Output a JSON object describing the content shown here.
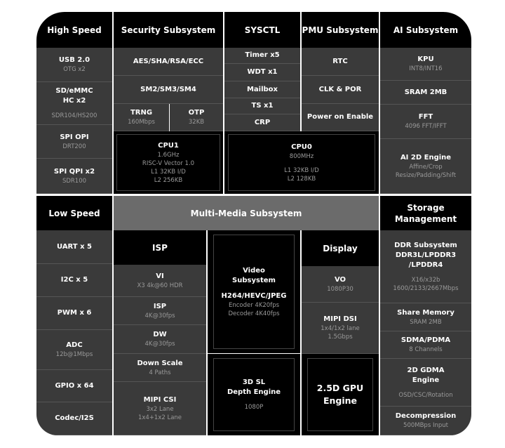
{
  "high_speed": {
    "header": "High Speed",
    "items": [
      {
        "title": "USB 2.0",
        "sub": "OTG x2"
      },
      {
        "title": "SD/eMMC\nHC x2",
        "sub": "SDR104/HS200"
      },
      {
        "title": "SPI OPI",
        "sub": "DRT200"
      },
      {
        "title": "SPI QPI x2",
        "sub": "SDR100"
      }
    ]
  },
  "security": {
    "header": "Security Subsystem",
    "items": [
      {
        "title": "AES/SHA/RSA/ECC"
      },
      {
        "title": "SM2/SM3/SM4"
      },
      {
        "title": "TRNG",
        "sub": "160Mbps"
      },
      {
        "title": "OTP",
        "sub": "32KB"
      }
    ]
  },
  "sysctl": {
    "header": "SYSCTL",
    "items": [
      {
        "title": "Timer x5"
      },
      {
        "title": "WDT x1"
      },
      {
        "title": "Mailbox"
      },
      {
        "title": "TS x1"
      },
      {
        "title": "CRP"
      }
    ]
  },
  "pmu": {
    "header": "PMU Subsystem",
    "items": [
      {
        "title": "RTC"
      },
      {
        "title": "CLK & POR"
      },
      {
        "title": "Power on Enable"
      }
    ]
  },
  "ai": {
    "header": "AI Subsystem",
    "items": [
      {
        "title": "KPU",
        "sub": "INT8/INT16"
      },
      {
        "title": "SRAM 2MB"
      },
      {
        "title": "FFT",
        "sub": "4096 FFT/IFFT"
      },
      {
        "title": "AI 2D Engine",
        "sub": "Affine/Crop\nResize/Padding/Shift"
      }
    ]
  },
  "cpu1": {
    "title": "CPU1",
    "sub": "1.6GHz\nRISC-V Vector 1.0\nL1 32KB I/D\nL2 256KB"
  },
  "cpu0": {
    "title": "CPU0",
    "sub": "800MHz",
    "sub2": "L1 32KB I/D\nL2 128KB"
  },
  "low_speed": {
    "header": "Low Speed",
    "items": [
      {
        "title": "UART x 5"
      },
      {
        "title": "I2C x 5"
      },
      {
        "title": "PWM x 6"
      },
      {
        "title": "ADC",
        "sub": "12b@1Mbps"
      },
      {
        "title": "GPIO x 64"
      },
      {
        "title": "Codec/I2S"
      }
    ]
  },
  "multimedia": {
    "header": "Multi-Media Subsystem"
  },
  "isp": {
    "header": "ISP",
    "items": [
      {
        "title": "VI",
        "sub": "X3 4k@60 HDR"
      },
      {
        "title": "ISP",
        "sub": "4K@30fps"
      },
      {
        "title": "DW",
        "sub": "4K@30fps"
      },
      {
        "title": "Down Scale",
        "sub": "4 Paths"
      },
      {
        "title": "MIPI CSI",
        "sub": "3x2 Lane\n1x4+1x2 Lane"
      }
    ]
  },
  "video": {
    "title": "Video\nSubsystem",
    "title2": "H264/HEVC/JPEG",
    "sub": "Encoder 4K20fps\nDecoder 4K40fps"
  },
  "depth": {
    "title": "3D SL\nDepth Engine",
    "sub": "1080P"
  },
  "display": {
    "header": "Display",
    "items": [
      {
        "title": "VO",
        "sub": "1080P30"
      },
      {
        "title": "MIPI DSI",
        "sub": "1x4/1x2 lane\n1.5Gbps"
      }
    ]
  },
  "gpu": {
    "title": "2.5D GPU\nEngine"
  },
  "storage": {
    "header": "Storage\nManagement",
    "items": [
      {
        "title": "DDR Subsystem\nDDR3L/LPDDR3\n/LPDDR4",
        "sub": "X16/x32b\n1600/2133/2667Mbps"
      },
      {
        "title": "Share Memory",
        "sub": "SRAM 2MB"
      },
      {
        "title": "SDMA/PDMA",
        "sub": "8 Channels"
      },
      {
        "title": "2D GDMA\nEngine",
        "sub": "OSD/CSC/Rotation"
      },
      {
        "title": "Decompression",
        "sub": "500MBps Input"
      }
    ]
  },
  "colors": {
    "cell": "#3a3a3a",
    "header": "#000000",
    "multimedia_header": "#6b6b6b",
    "subtext": "#9a9a9a"
  }
}
